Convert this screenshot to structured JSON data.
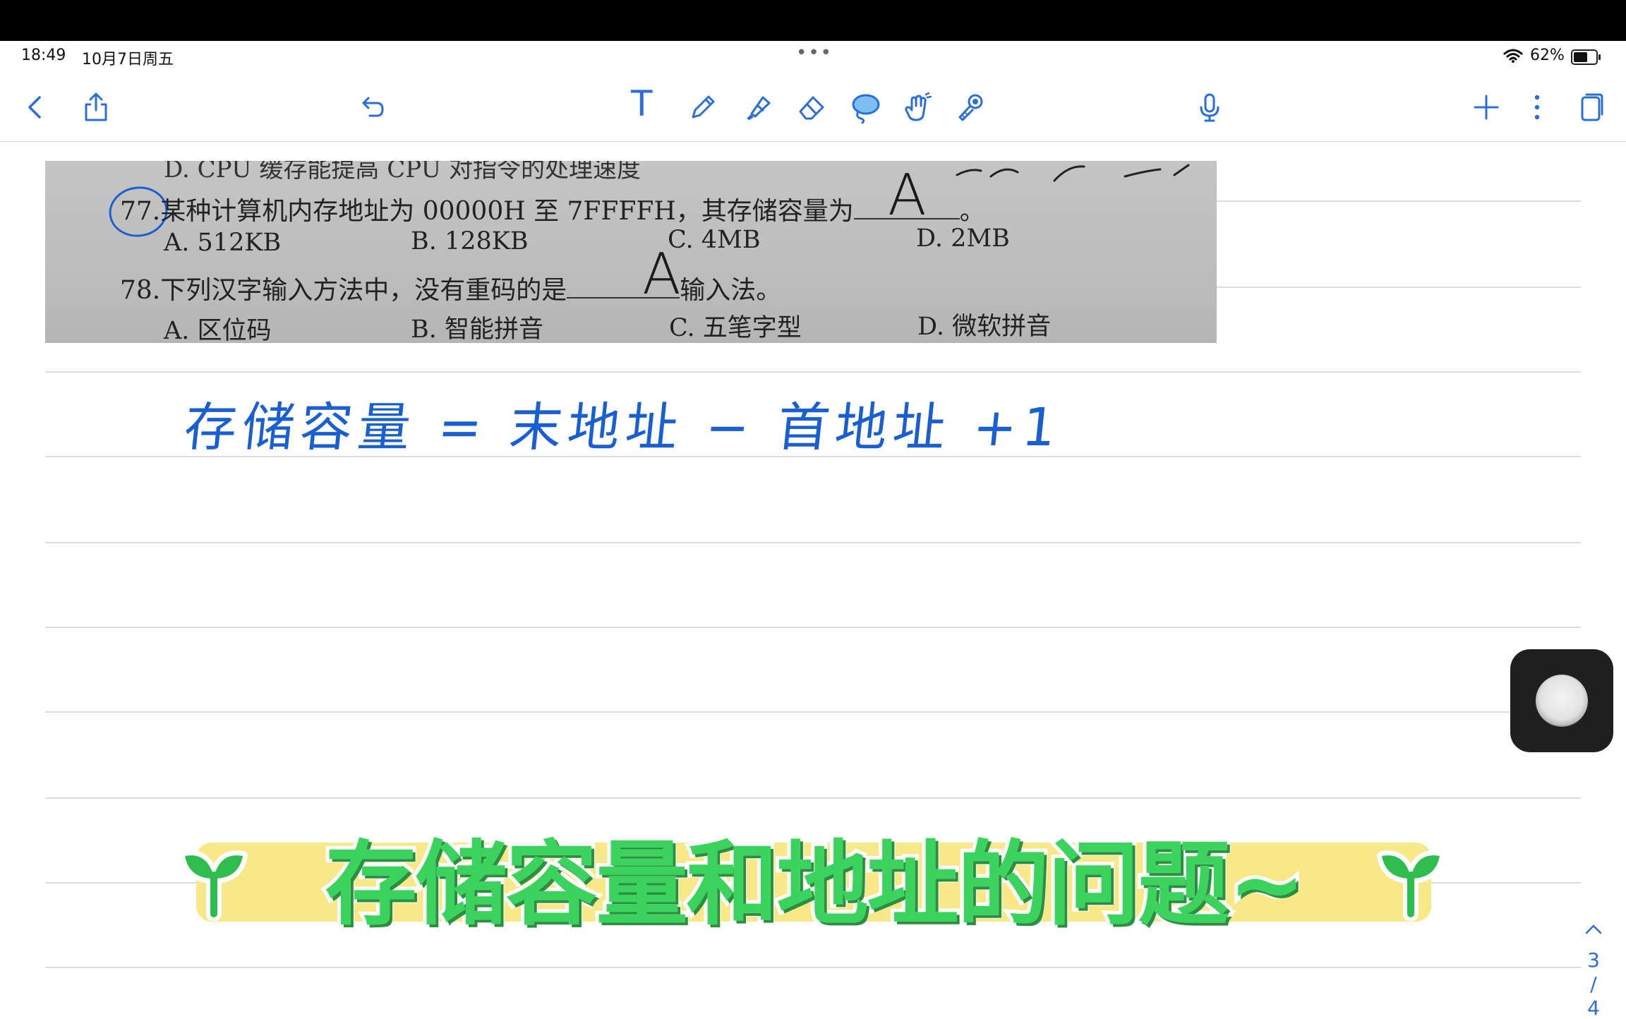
{
  "status_bar": {
    "time": "18:49",
    "date": "10月7日周五",
    "dots": "•••",
    "battery_percent_text": "62%",
    "battery_level": 0.62
  },
  "toolbar": {
    "icons": [
      "back-icon",
      "share-icon",
      "undo-icon",
      "text-tool-icon",
      "pen-icon",
      "highlighter-icon",
      "eraser-icon",
      "lasso-icon",
      "pointer-hand-icon",
      "laser-pointer-icon",
      "microphone-icon",
      "add-icon",
      "more-icon",
      "pages-icon"
    ],
    "text_tool_glyph": "T",
    "accent_color": "#2b6fd6"
  },
  "scan": {
    "cut_line": "D. CPU 缓存能提高 CPU 对指令的处理速度",
    "q77": {
      "number": "77.",
      "text_before": "某种计算机内存地址为 00000H 至 7FFFFH，其存储容量为",
      "text_after": "。",
      "answer": "A",
      "options": [
        "A. 512KB",
        "B. 128KB",
        "C. 4MB",
        "D. 2MB"
      ]
    },
    "q78": {
      "number": "78.",
      "text_before": "下列汉字输入方法中，没有重码的是",
      "text_after": "输入法。",
      "answer": "A",
      "options": [
        "A. 区位码",
        "B. 智能拼音",
        "C. 五笔字型",
        "D. 微软拼音"
      ]
    }
  },
  "handwritten_formula": "存储容量 = 末地址 − 首地址 +1",
  "caption": {
    "text": "存储容量和地址的问题~",
    "text_color": "#3bd35d",
    "band_color": "#f7e98a"
  },
  "pager": {
    "current": "3",
    "separator": "/",
    "total": "4"
  }
}
